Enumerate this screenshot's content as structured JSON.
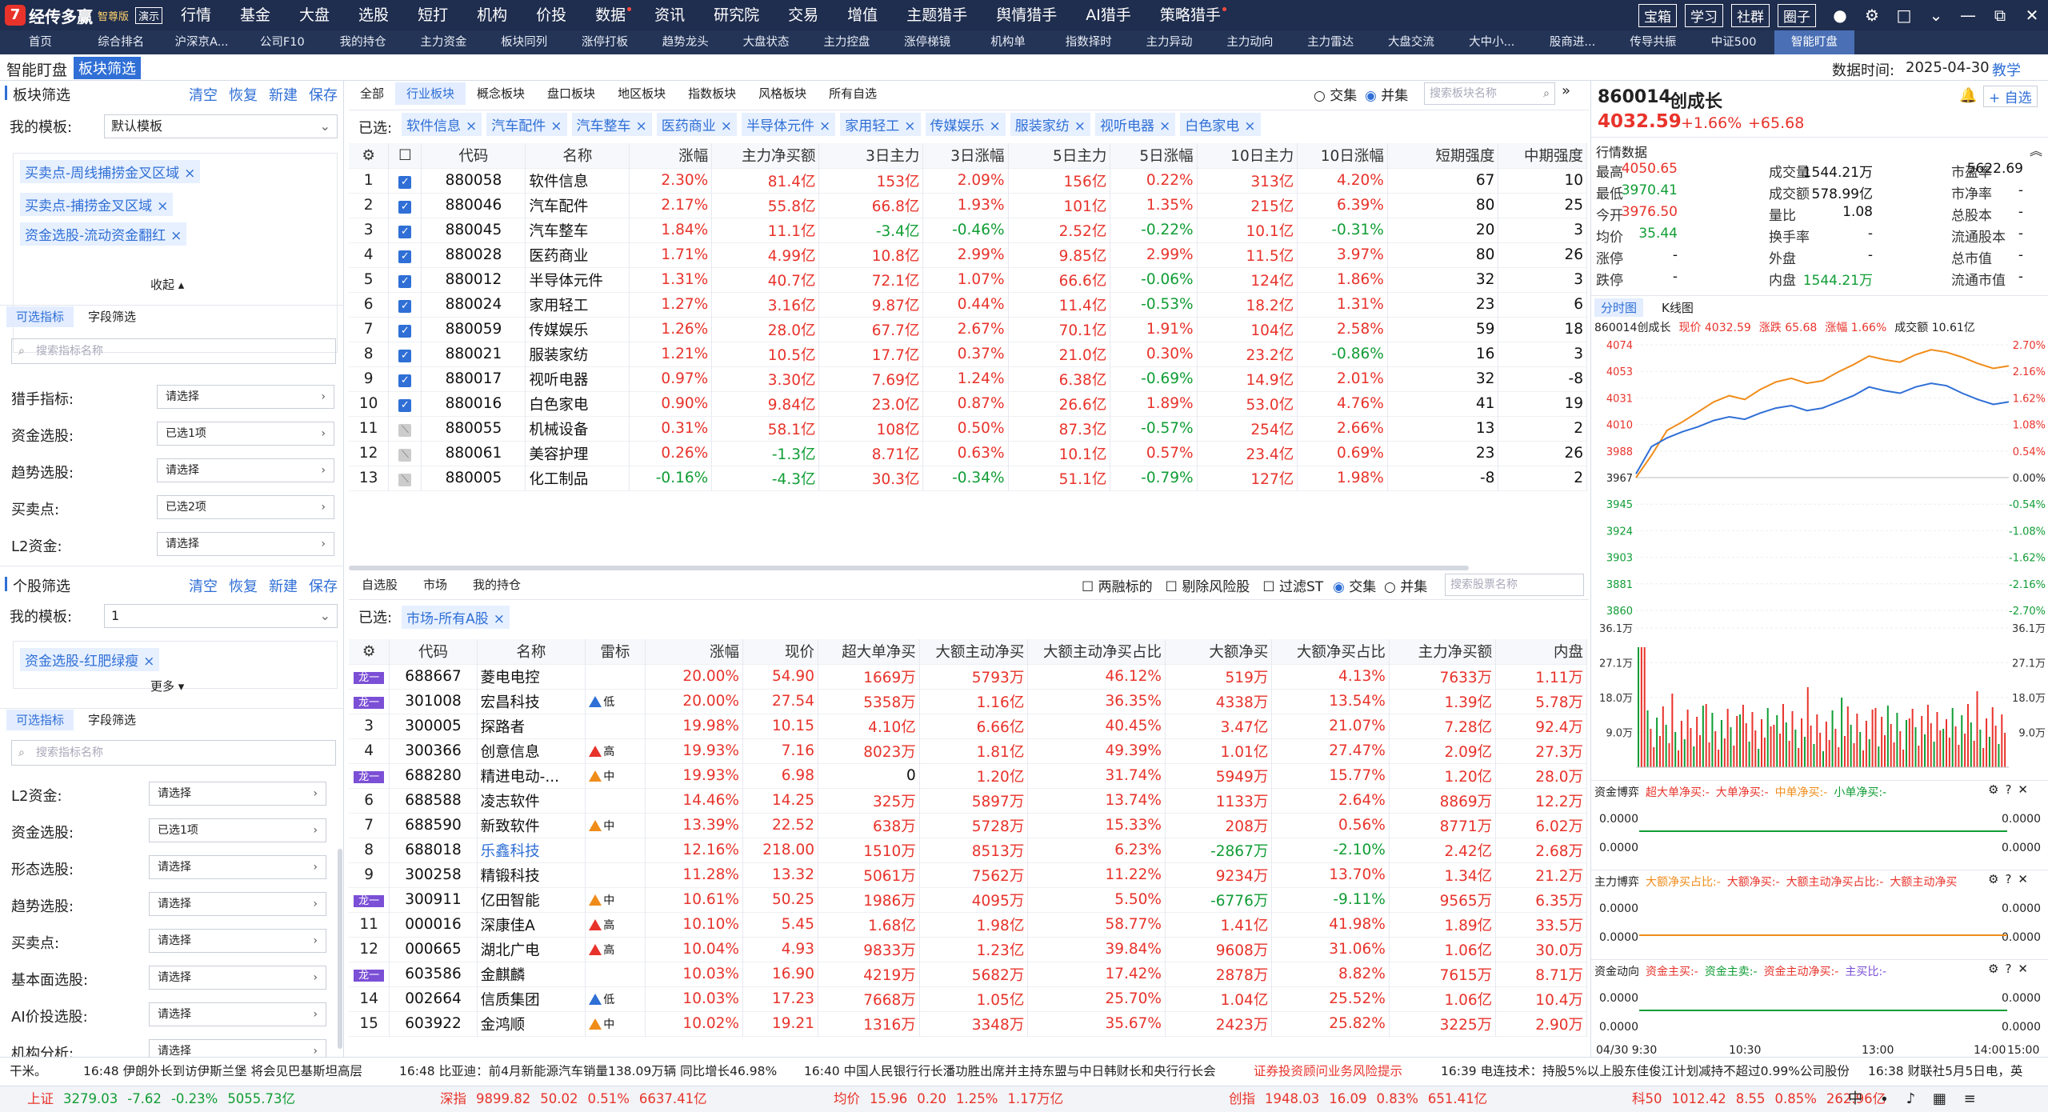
{
  "app": {
    "name": "经传多赢",
    "edition": "智尊版",
    "demo": "演示"
  },
  "menu": [
    {
      "label": "行情",
      "dot": false
    },
    {
      "label": "基金",
      "dot": false
    },
    {
      "label": "大盘",
      "dot": false
    },
    {
      "label": "选股",
      "dot": false
    },
    {
      "label": "短打",
      "dot": false
    },
    {
      "label": "机构",
      "dot": false
    },
    {
      "label": "价投",
      "dot": false
    },
    {
      "label": "数据",
      "dot": true
    },
    {
      "label": "资讯",
      "dot": false
    },
    {
      "label": "研究院",
      "dot": false
    },
    {
      "label": "交易",
      "dot": false
    },
    {
      "label": "增值",
      "dot": false
    },
    {
      "label": "主题猎手",
      "dot": false
    },
    {
      "label": "舆情猎手",
      "dot": false
    },
    {
      "label": "AI猎手",
      "dot": false
    },
    {
      "label": "策略猎手",
      "dot": true
    }
  ],
  "top_buttons": [
    "宝箱",
    "学习",
    "社群",
    "圈子"
  ],
  "tabs": [
    "首页",
    "综合排名",
    "沪深京A...",
    "公司F10",
    "我的持仓",
    "主力资金",
    "板块同列",
    "涨停打板",
    "趋势龙头",
    "大盘状态",
    "主力控盘",
    "涨停梯镜",
    "机构单",
    "指数择时",
    "主力异动",
    "主力动向",
    "主力雷达",
    "大盘交流",
    "大中小...",
    "股商进...",
    "传导共振",
    "中证500",
    "智能盯盘"
  ],
  "header": {
    "title": "智能盯盘",
    "tab": "板块筛选",
    "time_label": "数据时间:",
    "time_value": "2025-04-30",
    "teach": "教学"
  },
  "sector_filter": {
    "title": "板块筛选",
    "links": [
      "清空",
      "恢复",
      "新建",
      "保存"
    ],
    "template_label": "我的模板:",
    "template_value": "默认模板",
    "tags": [
      "买卖点-周线捕捞金叉区域",
      "买卖点-捕捞金叉区域",
      "资金选股-流动资金翻红"
    ],
    "collapse": "收起",
    "seg": [
      "可选指标",
      "字段筛选"
    ],
    "search_ph": "搜索指标名称",
    "rows": [
      {
        "label": "猎手指标:",
        "value": "请选择"
      },
      {
        "label": "资金选股:",
        "value": "已选1项"
      },
      {
        "label": "趋势选股:",
        "value": "请选择"
      },
      {
        "label": "买卖点:",
        "value": "已选2项"
      },
      {
        "label": "L2资金:",
        "value": "请选择"
      }
    ]
  },
  "stock_filter": {
    "title": "个股筛选",
    "links": [
      "清空",
      "恢复",
      "新建",
      "保存"
    ],
    "template_label": "我的模板:",
    "template_value": "1",
    "tags": [
      "资金选股-红肥绿瘦"
    ],
    "more": "更多",
    "seg": [
      "可选指标",
      "字段筛选"
    ],
    "search_ph": "搜索指标名称",
    "rows": [
      {
        "label": "L2资金:",
        "value": "请选择"
      },
      {
        "label": "资金选股:",
        "value": "已选1项"
      },
      {
        "label": "形态选股:",
        "value": "请选择"
      },
      {
        "label": "趋势选股:",
        "value": "请选择"
      },
      {
        "label": "买卖点:",
        "value": "请选择"
      },
      {
        "label": "基本面选股:",
        "value": "请选择"
      },
      {
        "label": "AI价投选股:",
        "value": "请选择"
      },
      {
        "label": "机构分析:",
        "value": "请选择"
      }
    ]
  },
  "sector_tabs": [
    "全部",
    "行业板块",
    "概念板块",
    "盘口板块",
    "地区板块",
    "指数板块",
    "风格板块",
    "所有自选"
  ],
  "sector_radio": [
    "交集",
    "并集"
  ],
  "sector_search_ph": "搜索板块名称",
  "sector_selected_label": "已选:",
  "sector_selected": [
    "软件信息",
    "汽车配件",
    "汽车整车",
    "医药商业",
    "半导体元件",
    "家用轻工",
    "传媒娱乐",
    "服装家纺",
    "视听电器",
    "白色家电"
  ],
  "sector_cols": [
    "代码",
    "名称",
    "涨幅",
    "主力净买额",
    "3日主力",
    "3日涨幅",
    "5日主力",
    "5日涨幅",
    "10日主力",
    "10日涨幅",
    "短期强度",
    "中期强度"
  ],
  "sector_rows": [
    [
      "1",
      true,
      "880058",
      "软件信息",
      "2.30%",
      "81.4亿",
      "153亿",
      "2.09%",
      "156亿",
      "0.22%",
      "313亿",
      "4.20%",
      "67",
      "10"
    ],
    [
      "2",
      true,
      "880046",
      "汽车配件",
      "2.17%",
      "55.8亿",
      "66.8亿",
      "1.93%",
      "101亿",
      "1.35%",
      "215亿",
      "6.39%",
      "80",
      "25"
    ],
    [
      "3",
      true,
      "880045",
      "汽车整车",
      "1.84%",
      "11.1亿",
      "-3.4亿",
      "-0.46%",
      "2.52亿",
      "-0.22%",
      "10.1亿",
      "-0.31%",
      "20",
      "3"
    ],
    [
      "4",
      true,
      "880028",
      "医药商业",
      "1.71%",
      "4.99亿",
      "10.8亿",
      "2.99%",
      "9.85亿",
      "2.99%",
      "11.5亿",
      "3.97%",
      "80",
      "26"
    ],
    [
      "5",
      true,
      "880012",
      "半导体元件",
      "1.31%",
      "40.7亿",
      "72.1亿",
      "1.07%",
      "66.6亿",
      "-0.06%",
      "124亿",
      "1.86%",
      "32",
      "3"
    ],
    [
      "6",
      true,
      "880024",
      "家用轻工",
      "1.27%",
      "3.16亿",
      "9.87亿",
      "0.44%",
      "11.4亿",
      "-0.53%",
      "18.2亿",
      "1.31%",
      "23",
      "6"
    ],
    [
      "7",
      true,
      "880059",
      "传媒娱乐",
      "1.26%",
      "28.0亿",
      "67.7亿",
      "2.67%",
      "70.1亿",
      "1.91%",
      "104亿",
      "2.58%",
      "59",
      "18"
    ],
    [
      "8",
      true,
      "880021",
      "服装家纺",
      "1.21%",
      "10.5亿",
      "17.7亿",
      "0.37%",
      "21.0亿",
      "0.30%",
      "23.2亿",
      "-0.86%",
      "16",
      "3"
    ],
    [
      "9",
      true,
      "880017",
      "视听电器",
      "0.97%",
      "3.30亿",
      "7.69亿",
      "1.24%",
      "6.38亿",
      "-0.69%",
      "14.9亿",
      "2.01%",
      "32",
      "-8"
    ],
    [
      "10",
      true,
      "880016",
      "白色家电",
      "0.90%",
      "9.84亿",
      "23.0亿",
      "0.87%",
      "26.6亿",
      "1.89%",
      "53.0亿",
      "4.76%",
      "41",
      "19"
    ],
    [
      "11",
      false,
      "880055",
      "机械设备",
      "0.31%",
      "58.1亿",
      "108亿",
      "0.50%",
      "87.3亿",
      "-0.57%",
      "254亿",
      "2.66%",
      "13",
      "2"
    ],
    [
      "12",
      false,
      "880061",
      "美容护理",
      "0.26%",
      "-1.3亿",
      "8.71亿",
      "0.63%",
      "10.1亿",
      "0.57%",
      "23.4亿",
      "0.69%",
      "23",
      "26"
    ],
    [
      "13",
      false,
      "880005",
      "化工制品",
      "-0.16%",
      "-4.3亿",
      "30.3亿",
      "-0.34%",
      "51.1亿",
      "-0.79%",
      "127亿",
      "1.98%",
      "-8",
      "2"
    ]
  ],
  "stock_tabs": [
    "自选股",
    "市场",
    "我的持仓"
  ],
  "stock_opts": [
    "两融标的",
    "剔除风险股",
    "过滤ST"
  ],
  "stock_radio": [
    "交集",
    "并集"
  ],
  "stock_search_ph": "搜索股票名称",
  "stock_selected_label": "已选:",
  "stock_selected": [
    "市场-所有A股"
  ],
  "stock_cols": [
    "代码",
    "名称",
    "雷标",
    "涨幅",
    "现价",
    "超大单净买",
    "大额主动净买",
    "大额主动净买占比",
    "大额净买",
    "大额净买占比",
    "主力净买额",
    "内盘"
  ],
  "stock_rows": [
    [
      "龙一",
      "688667",
      "菱电电控",
      "",
      "20.00%",
      "54.90",
      "1669万",
      "5793万",
      "46.12%",
      "519万",
      "4.13%",
      "7633万",
      "1.11万"
    ],
    [
      "龙一",
      "301008",
      "宏昌科技",
      "低",
      "20.00%",
      "27.54",
      "5358万",
      "1.16亿",
      "36.35%",
      "4338万",
      "13.54%",
      "1.39亿",
      "5.78万"
    ],
    [
      "3",
      "300005",
      "探路者",
      "",
      "19.98%",
      "10.15",
      "4.10亿",
      "6.66亿",
      "40.45%",
      "3.47亿",
      "21.07%",
      "7.28亿",
      "92.4万"
    ],
    [
      "4",
      "300366",
      "创意信息",
      "高",
      "19.93%",
      "7.16",
      "8023万",
      "1.81亿",
      "49.39%",
      "1.01亿",
      "27.47%",
      "2.09亿",
      "27.3万"
    ],
    [
      "龙一",
      "688280",
      "精进电动-...",
      "中",
      "19.93%",
      "6.98",
      "0",
      "1.20亿",
      "31.74%",
      "5949万",
      "15.77%",
      "1.20亿",
      "28.0万"
    ],
    [
      "6",
      "688588",
      "凌志软件",
      "",
      "14.46%",
      "14.25",
      "325万",
      "5897万",
      "13.74%",
      "1133万",
      "2.64%",
      "8869万",
      "12.2万"
    ],
    [
      "7",
      "688590",
      "新致软件",
      "中",
      "13.39%",
      "22.52",
      "638万",
      "5728万",
      "15.33%",
      "208万",
      "0.56%",
      "8771万",
      "6.02万"
    ],
    [
      "8",
      "688018",
      "乐鑫科技",
      "",
      "12.16%",
      "218.00",
      "1510万",
      "8513万",
      "6.23%",
      "-2867万",
      "-2.10%",
      "2.42亿",
      "2.68万"
    ],
    [
      "9",
      "300258",
      "精锻科技",
      "",
      "11.28%",
      "13.32",
      "5061万",
      "7562万",
      "11.22%",
      "9234万",
      "13.70%",
      "1.34亿",
      "21.2万"
    ],
    [
      "龙一",
      "300911",
      "亿田智能",
      "中",
      "10.61%",
      "50.25",
      "1986万",
      "4095万",
      "5.50%",
      "-6776万",
      "-9.11%",
      "9565万",
      "6.35万"
    ],
    [
      "11",
      "000016",
      "深康佳A",
      "高",
      "10.10%",
      "5.45",
      "1.68亿",
      "1.98亿",
      "58.77%",
      "1.41亿",
      "41.98%",
      "1.89亿",
      "33.5万"
    ],
    [
      "12",
      "000665",
      "湖北广电",
      "高",
      "10.04%",
      "4.93",
      "9833万",
      "1.23亿",
      "39.84%",
      "9608万",
      "31.06%",
      "1.06亿",
      "30.0万"
    ],
    [
      "龙一",
      "603586",
      "金麒麟",
      "",
      "10.03%",
      "16.90",
      "4219万",
      "5682万",
      "17.42%",
      "2878万",
      "8.82%",
      "7615万",
      "8.71万"
    ],
    [
      "14",
      "002664",
      "信质集团",
      "低",
      "10.03%",
      "17.23",
      "7668万",
      "1.05亿",
      "25.70%",
      "1.04亿",
      "25.52%",
      "1.06亿",
      "10.4万"
    ],
    [
      "15",
      "603922",
      "金鸿顺",
      "中",
      "10.02%",
      "19.21",
      "1316万",
      "3348万",
      "35.67%",
      "2423万",
      "25.82%",
      "3225万",
      "2.90万"
    ]
  ],
  "quote": {
    "code": "860014",
    "name": "创成长",
    "price": "4032.59",
    "pct": "+1.66%",
    "chg": "+65.68",
    "add": "自选",
    "section": "行情数据",
    "fields": [
      [
        "最高",
        "4050.65",
        "成交量",
        "1544.21万",
        "市盈率",
        "5622.69"
      ],
      [
        "最低",
        "3970.41",
        "成交额",
        "578.99亿",
        "市净率",
        "-"
      ],
      [
        "今开",
        "3976.50",
        "量比",
        "1.08",
        "总股本",
        "-"
      ],
      [
        "均价",
        "35.44",
        "换手率",
        "-",
        "流通股本",
        "-"
      ],
      [
        "涨停",
        "-",
        "外盘",
        "-",
        "总市值",
        "-"
      ],
      [
        "跌停",
        "-",
        "内盘",
        "1544.21万",
        "流通市值",
        "-"
      ]
    ],
    "chart_tabs": [
      "分时图",
      "K线图"
    ],
    "chart_info": [
      "860014创成长",
      "现价 4032.59",
      "涨跌 65.68",
      "涨幅 1.66%",
      "成交额 10.61亿"
    ]
  },
  "chart_data": {
    "type": "line",
    "y_left": [
      "4074",
      "4053",
      "4031",
      "4010",
      "3988",
      "3967",
      "3945",
      "3924",
      "3903",
      "3881",
      "3860"
    ],
    "y_right": [
      "2.70%",
      "2.16%",
      "1.62%",
      "1.08%",
      "0.54%",
      "0.00%",
      "-0.54%",
      "-1.08%",
      "-1.62%",
      "-2.16%",
      "-2.70%"
    ],
    "vol_labels": [
      "36.1万",
      "27.1万",
      "18.0万",
      "9.0万"
    ],
    "x_labels": [
      "04/30 9:30",
      "10:30",
      "13:00",
      "14:00",
      "15:00"
    ],
    "series": [
      {
        "name": "现价",
        "values": [
          3967,
          3985,
          4005,
          4012,
          4020,
          4028,
          4033,
          4030,
          4038,
          4044,
          4047,
          4043,
          4045,
          4052,
          4058,
          4065,
          4062,
          4060,
          4066,
          4070,
          4068,
          4064,
          4059,
          4055,
          4057
        ]
      },
      {
        "name": "",
        "values": [
          3970,
          3992,
          3999,
          4004,
          4008,
          4013,
          4016,
          4014,
          4019,
          4023,
          4025,
          4021,
          4023,
          4028,
          4033,
          4040,
          4037,
          4035,
          4040,
          4043,
          4041,
          4035,
          4030,
          4026,
          4028
        ]
      }
    ]
  },
  "sub_panels": [
    {
      "title": "资金博弈",
      "legend": [
        "超大单净买:-",
        "大单净买:-",
        "中单净买:-",
        "小单净买:-"
      ],
      "val": "0.0000"
    },
    {
      "title": "主力博弈",
      "legend": [
        "大额净买占比:-",
        "大额净买:-",
        "大额主动净买占比:-",
        "大额主动净买"
      ],
      "val": "0.0000"
    },
    {
      "title": "资金动向",
      "legend": [
        "资金主买:-",
        "资金主卖:-",
        "资金主动净买:-",
        "主买比:-"
      ],
      "val": "0.0000"
    }
  ],
  "ticker": [
    "干米。",
    "16:48 伊朗外长到访伊斯兰堡 将会见巴基斯坦高层",
    "16:48 比亚迪：前4月新能源汽车销量138.09万辆 同比增长46.98%",
    "16:40 中国人民银行行长潘功胜出席并主持东盟与中日韩财长和央行行长会",
    "证券投资顾问业务风险提示",
    "16:39 电连技术：持股5%以上股东佳俊江计划减持不超过0.99%公司股份",
    "16:38 财联社5月5日电，英"
  ],
  "status": [
    {
      "name": "上证",
      "v": "3279.03",
      "c": "-7.62",
      "p": "-0.23%",
      "a": "5055.73亿",
      "cls": "g"
    },
    {
      "name": "深指",
      "v": "9899.82",
      "c": "50.02",
      "p": "0.51%",
      "a": "6637.41亿",
      "cls": "r"
    },
    {
      "name": "均价",
      "v": "15.96",
      "c": "0.20",
      "p": "1.25%",
      "a": "1.17万亿",
      "cls": "r"
    },
    {
      "name": "创指",
      "v": "1948.03",
      "c": "16.09",
      "p": "0.83%",
      "a": "651.41亿",
      "cls": "r"
    },
    {
      "name": "科50",
      "v": "1012.42",
      "c": "8.55",
      "p": "0.85%",
      "a": "262.96亿",
      "cls": "r"
    }
  ],
  "colors": {
    "accent": "#2f6fd6",
    "up": "#e8332b",
    "down": "#109d35",
    "titlebar": "#1f2d4e"
  }
}
